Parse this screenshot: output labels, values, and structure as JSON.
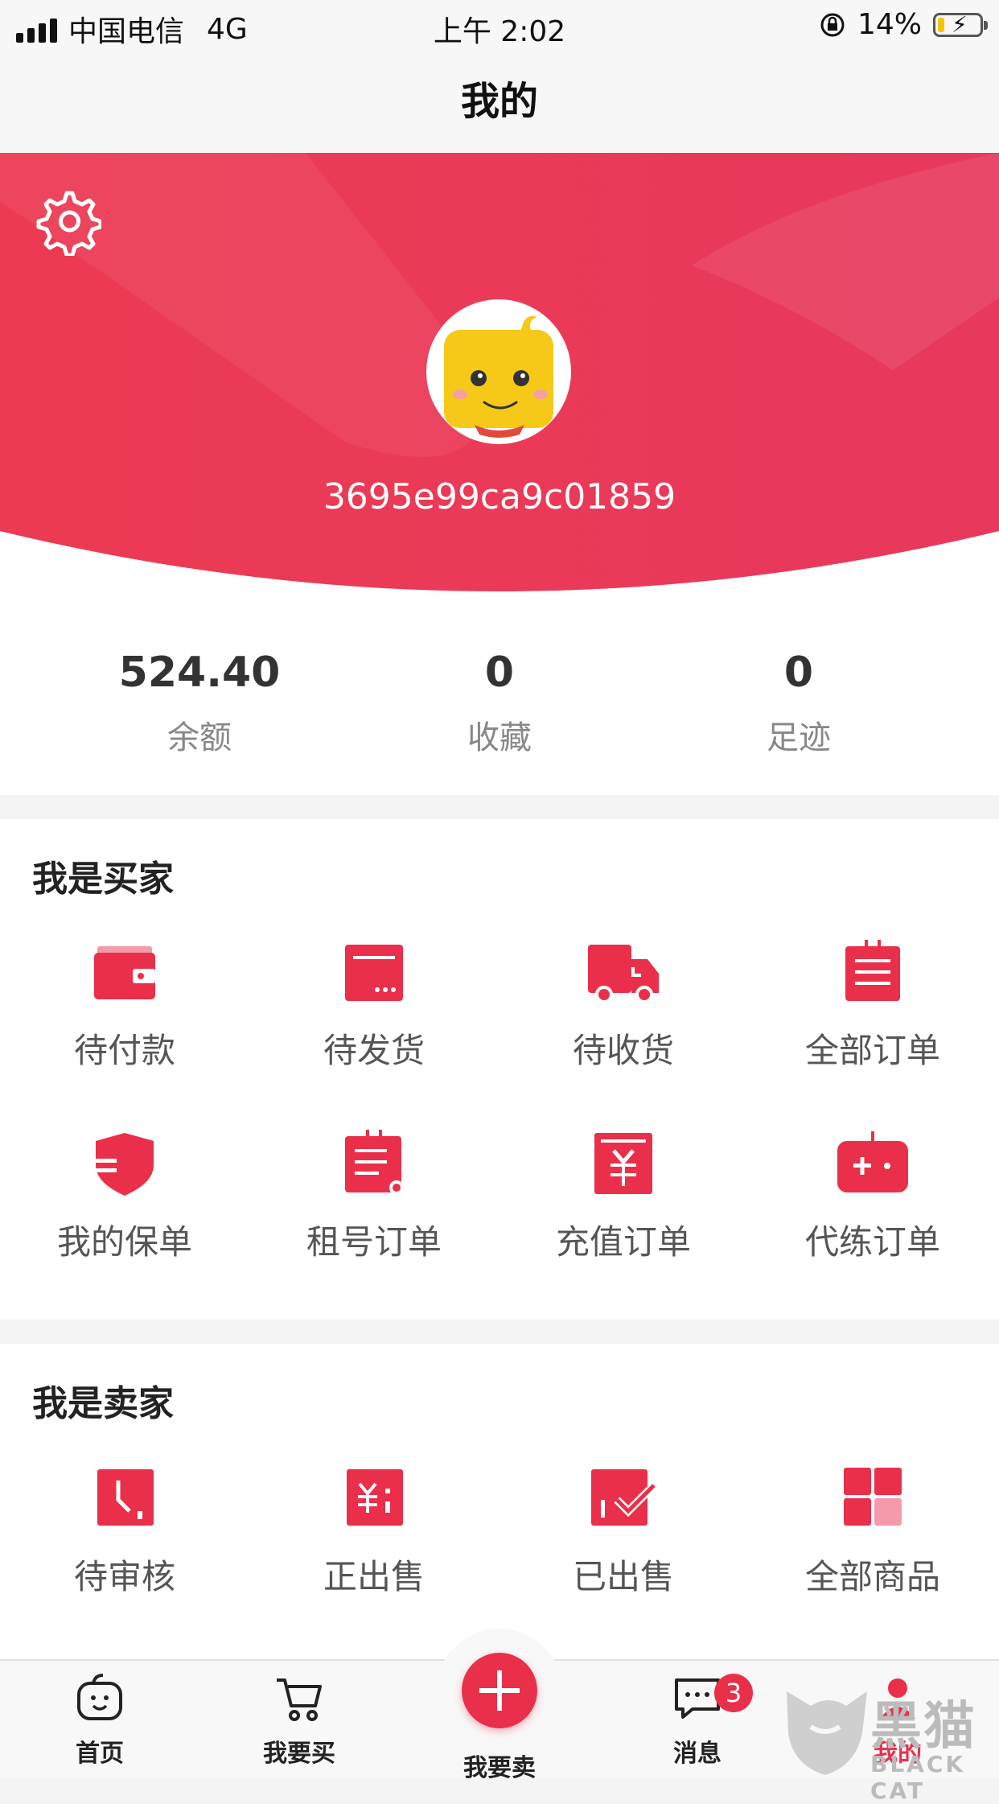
{
  "status_bar": {
    "carrier": "中国电信",
    "network": "4G",
    "time": "上午 2:02",
    "battery": "14%"
  },
  "nav": {
    "title": "我的"
  },
  "profile": {
    "username": "3695e99ca9c01859"
  },
  "stats": [
    {
      "value": "524.40",
      "label": "余额"
    },
    {
      "value": "0",
      "label": "收藏"
    },
    {
      "value": "0",
      "label": "足迹"
    }
  ],
  "buyer": {
    "title": "我是买家",
    "items": [
      {
        "label": "待付款",
        "icon": "wallet-icon"
      },
      {
        "label": "待发货",
        "icon": "package-icon"
      },
      {
        "label": "待收货",
        "icon": "truck-icon"
      },
      {
        "label": "全部订单",
        "icon": "order-list-icon"
      },
      {
        "label": "我的保单",
        "icon": "shield-icon"
      },
      {
        "label": "租号订单",
        "icon": "rent-order-icon"
      },
      {
        "label": "充值订单",
        "icon": "recharge-icon"
      },
      {
        "label": "代练订单",
        "icon": "gamepad-icon"
      }
    ]
  },
  "seller": {
    "title": "我是卖家",
    "items": [
      {
        "label": "待审核",
        "icon": "clock-icon"
      },
      {
        "label": "正出售",
        "icon": "on-sale-icon"
      },
      {
        "label": "已出售",
        "icon": "sold-icon"
      },
      {
        "label": "全部商品",
        "icon": "grid-icon"
      }
    ]
  },
  "tabbar": {
    "items": [
      {
        "label": "首页",
        "icon": "home-face-icon"
      },
      {
        "label": "我要买",
        "icon": "cart-icon"
      },
      {
        "label": "我要卖",
        "icon": "plus-icon"
      },
      {
        "label": "消息",
        "icon": "message-icon",
        "badge": "3"
      },
      {
        "label": "我的",
        "icon": "profile-icon"
      }
    ]
  },
  "watermark": {
    "cn": "黑猫",
    "en": "BLACK CAT"
  },
  "colors": {
    "accent": "#ea2f4a",
    "accent_light": "#f49aab",
    "hero": "#ea3450"
  }
}
